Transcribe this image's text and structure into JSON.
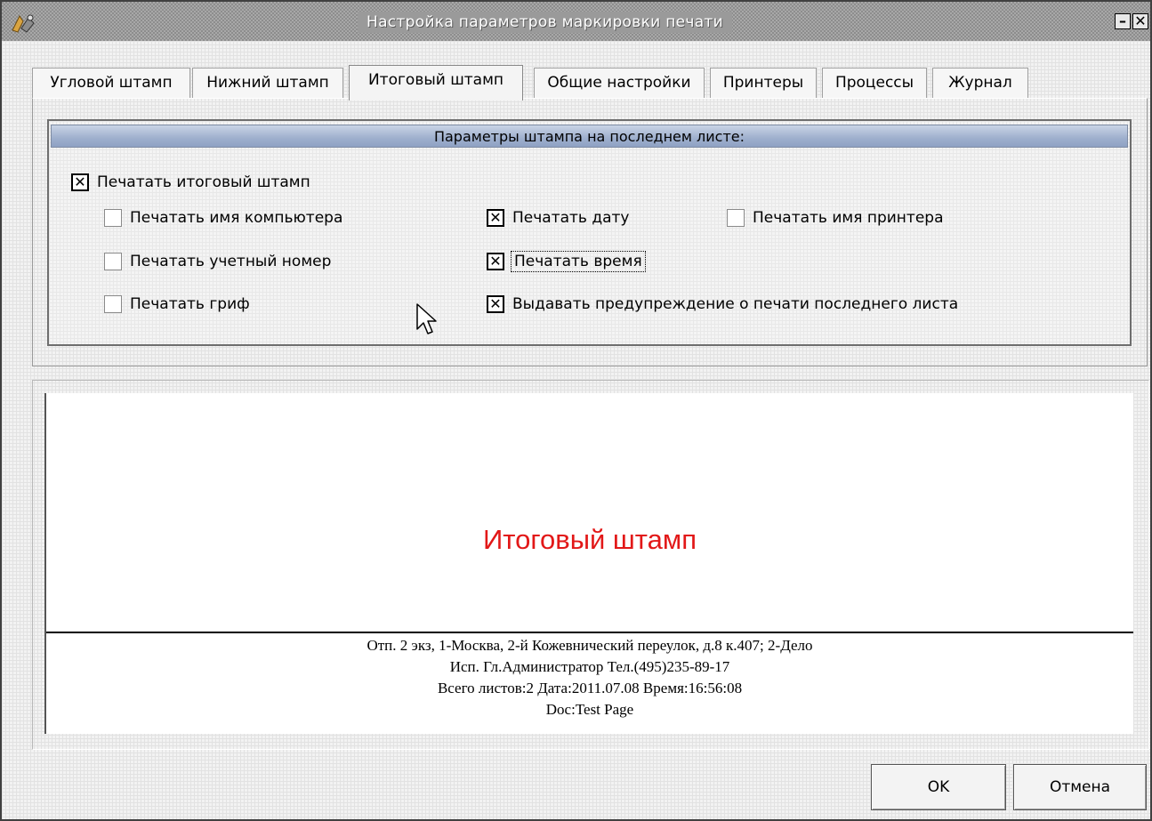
{
  "window": {
    "title": "Настройка параметров маркировки печати",
    "minimize_glyph": "–",
    "close_glyph": "✕"
  },
  "tabs": [
    {
      "label": "Угловой штамп",
      "active": false
    },
    {
      "label": "Нижний штамп",
      "active": false
    },
    {
      "label": "Итоговый штамп",
      "active": true
    },
    {
      "label": "Общие настройки",
      "active": false
    },
    {
      "label": "Принтеры",
      "active": false
    },
    {
      "label": "Процессы",
      "active": false
    },
    {
      "label": "Журнал",
      "active": false
    }
  ],
  "group": {
    "header": "Параметры штампа на последнем листе:"
  },
  "checkboxes": {
    "print_final_stamp": {
      "label": "Печатать итоговый штамп",
      "checked": true
    },
    "print_computer_name": {
      "label": "Печатать имя компьютера",
      "checked": false
    },
    "print_account_number": {
      "label": "Печатать учетный номер",
      "checked": false
    },
    "print_classification": {
      "label": "Печатать гриф",
      "checked": false
    },
    "print_date": {
      "label": "Печатать дату",
      "checked": true
    },
    "print_time": {
      "label": "Печатать время",
      "checked": true
    },
    "warn_last_page": {
      "label": "Выдавать предупреждение о печати последнего листа",
      "checked": true
    },
    "print_printer_name": {
      "label": "Печатать имя принтера",
      "checked": false
    }
  },
  "check_glyph": "✕",
  "preview": {
    "title": "Итоговый штамп",
    "title_color": "#e21818",
    "lines": [
      "Отп. 2 экз, 1-Москва, 2-й Кожевнический переулок, д.8 к.407; 2-Дело",
      "Исп. Гл.Администратор Тел.(495)235-89-17",
      "Всего листов:2 Дата:2011.07.08 Время:16:56:08",
      "Doc:Test Page"
    ]
  },
  "buttons": {
    "ok": "OK",
    "cancel": "Отмена"
  },
  "icons": {
    "app": "settings-app-icon",
    "cursor": "mouse-pointer-icon"
  }
}
